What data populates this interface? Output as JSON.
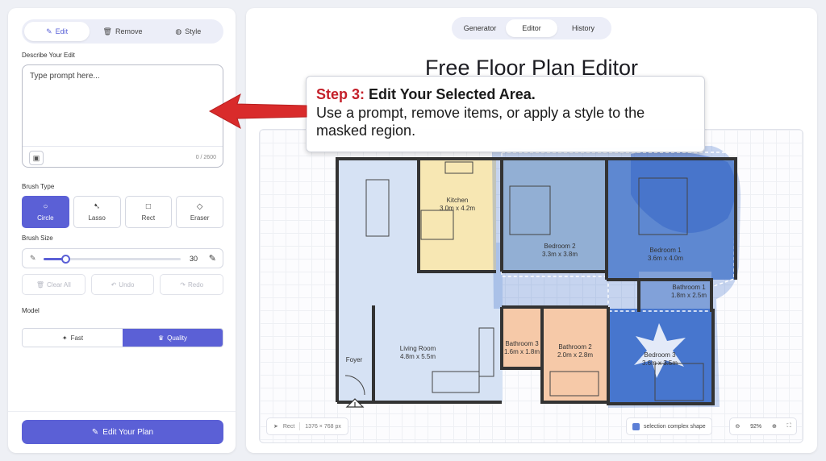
{
  "mode_tabs": [
    {
      "label": "Edit",
      "icon": "edit-square-icon",
      "active": true
    },
    {
      "label": "Remove",
      "icon": "trash-icon",
      "active": false
    },
    {
      "label": "Style",
      "icon": "palette-icon",
      "active": false
    }
  ],
  "prompt": {
    "label": "Describe Your Edit",
    "placeholder": "Type prompt here...",
    "char_count": "0 / 2600"
  },
  "brush_type": {
    "label": "Brush Type",
    "options": [
      {
        "label": "Circle",
        "icon": "circle-icon",
        "active": true
      },
      {
        "label": "Lasso",
        "icon": "lasso-icon",
        "active": false
      },
      {
        "label": "Rect",
        "icon": "square-icon",
        "active": false
      },
      {
        "label": "Eraser",
        "icon": "eraser-icon",
        "active": false
      }
    ]
  },
  "brush_size": {
    "label": "Brush Size",
    "value": "30",
    "fraction": 0.16
  },
  "actions": {
    "clear": "Clear All",
    "undo": "Undo",
    "redo": "Redo"
  },
  "model": {
    "label": "Model",
    "options": [
      {
        "label": "Fast",
        "icon": "sparkle-icon",
        "active": false
      },
      {
        "label": "Quality",
        "icon": "crown-icon",
        "active": true
      }
    ]
  },
  "edit_plan_button": "Edit Your Plan",
  "nav_tabs": [
    {
      "label": "Generator",
      "active": false
    },
    {
      "label": "Editor",
      "active": true
    },
    {
      "label": "History",
      "active": false
    }
  ],
  "page_title": "Free Floor Plan Editor",
  "rooms": [
    {
      "name": "Kitchen",
      "size": "3.0m x 4.2m"
    },
    {
      "name": "Bedroom 2",
      "size": "3.3m x 3.8m"
    },
    {
      "name": "Bedroom 1",
      "size": "3.6m x 4.0m"
    },
    {
      "name": "Bathroom 1",
      "size": "1.8m x 2.5m"
    },
    {
      "name": "Living Room",
      "size": "4.8m x 5.5m"
    },
    {
      "name": "Foyer",
      "size": ""
    },
    {
      "name": "Bathroom 3",
      "size": "1.6m x 1.8m"
    },
    {
      "name": "Bathroom 2",
      "size": "2.0m x 2.8m"
    },
    {
      "name": "Bedroom 3",
      "size": "3.6m x 3.5m"
    }
  ],
  "canvas_footer": {
    "tool": "Rect",
    "dimensions": "1376 × 768 px",
    "selection": "selection complex shape",
    "zoom": "92%"
  },
  "callout": {
    "step": "Step 3:",
    "title": "Edit Your Selected Area.",
    "body": "Use a prompt, remove items, or apply a style to the masked region."
  },
  "colors": {
    "accent": "#5b60d6",
    "callout_red": "#c4202a",
    "mask_blue": "#3a6cc8",
    "kitchen": "#f7e7b3",
    "bath": "#f6c9a8",
    "living": "#d6e2f4"
  }
}
